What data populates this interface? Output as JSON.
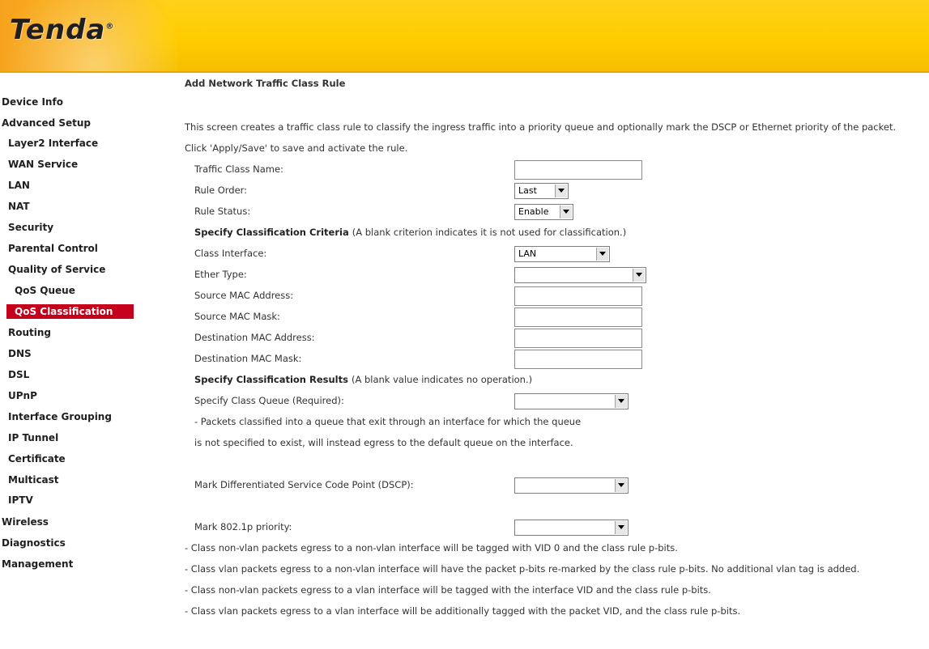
{
  "header": {
    "logo_text": "Tenda",
    "logo_mark": "®",
    "colors": {
      "header_yellow": "#ffcc00",
      "header_orange": "#f7a21e",
      "active_nav_bg": "#c4001a"
    }
  },
  "sidebar": {
    "items": [
      {
        "label": "Device Info",
        "level": 1
      },
      {
        "label": "Advanced Setup",
        "level": 1
      },
      {
        "label": "Layer2 Interface",
        "level": 2
      },
      {
        "label": "WAN Service",
        "level": 2
      },
      {
        "label": "LAN",
        "level": 2
      },
      {
        "label": "NAT",
        "level": 2
      },
      {
        "label": "Security",
        "level": 2
      },
      {
        "label": "Parental Control",
        "level": 2
      },
      {
        "label": "Quality of Service",
        "level": 2
      },
      {
        "label": "QoS Queue",
        "level": 3
      },
      {
        "label": "QoS Classification",
        "level": 3,
        "active": true
      },
      {
        "label": "Routing",
        "level": 2
      },
      {
        "label": "DNS",
        "level": 2
      },
      {
        "label": "DSL",
        "level": 2
      },
      {
        "label": "UPnP",
        "level": 2
      },
      {
        "label": "Interface Grouping",
        "level": 2
      },
      {
        "label": "IP Tunnel",
        "level": 2
      },
      {
        "label": "Certificate",
        "level": 2
      },
      {
        "label": "Multicast",
        "level": 2
      },
      {
        "label": "IPTV",
        "level": 2
      },
      {
        "label": "Wireless",
        "level": 1
      },
      {
        "label": "Diagnostics",
        "level": 1
      },
      {
        "label": "Management",
        "level": 1
      }
    ]
  },
  "main": {
    "title": "Add Network Traffic Class Rule",
    "intro_line1": "This screen creates a traffic class rule to classify the ingress traffic into a priority queue and optionally mark the DSCP or Ethernet priority of the packet.",
    "intro_line2": "Click 'Apply/Save' to save and activate the rule.",
    "fields": {
      "traffic_class_name": {
        "label": "Traffic Class Name:",
        "value": ""
      },
      "rule_order": {
        "label": "Rule Order:",
        "value": "Last"
      },
      "rule_status": {
        "label": "Rule Status:",
        "value": "Enable"
      }
    },
    "criteria": {
      "heading": "Specify Classification Criteria",
      "note": "(A blank criterion indicates it is not used for classification.)",
      "class_interface": {
        "label": "Class Interface:",
        "value": "LAN"
      },
      "ether_type": {
        "label": "Ether Type:",
        "value": ""
      },
      "source_mac_address": {
        "label": "Source MAC Address:",
        "value": ""
      },
      "source_mac_mask": {
        "label": "Source MAC Mask:",
        "value": ""
      },
      "destination_mac_address": {
        "label": "Destination MAC Address:",
        "value": ""
      },
      "destination_mac_mask": {
        "label": "Destination MAC Mask:",
        "value": ""
      }
    },
    "results": {
      "heading": "Specify Classification Results",
      "note": "(A blank value indicates no operation.)",
      "class_queue": {
        "label": "Specify Class Queue (Required):",
        "value": ""
      },
      "queue_note_line1": "- Packets classified into a queue that exit through an interface for which the queue",
      "queue_note_line2": "is not specified to exist, will instead egress to the default queue on the interface.",
      "dscp": {
        "label": "Mark Differentiated Service Code Point (DSCP):",
        "value": ""
      },
      "priority_8021p": {
        "label": "Mark 802.1p priority:",
        "value": ""
      },
      "notes": [
        "- Class non-vlan packets egress to a non-vlan interface will be tagged with VID 0 and the class rule p-bits.",
        "- Class vlan packets egress to a non-vlan interface will have the packet p-bits re-marked by the class rule p-bits. No additional vlan tag is added.",
        "- Class non-vlan packets egress to a vlan interface will be tagged with the interface VID and the class rule p-bits.",
        "- Class vlan packets egress to a vlan interface will be additionally tagged with the packet VID, and the class rule p-bits."
      ]
    }
  }
}
